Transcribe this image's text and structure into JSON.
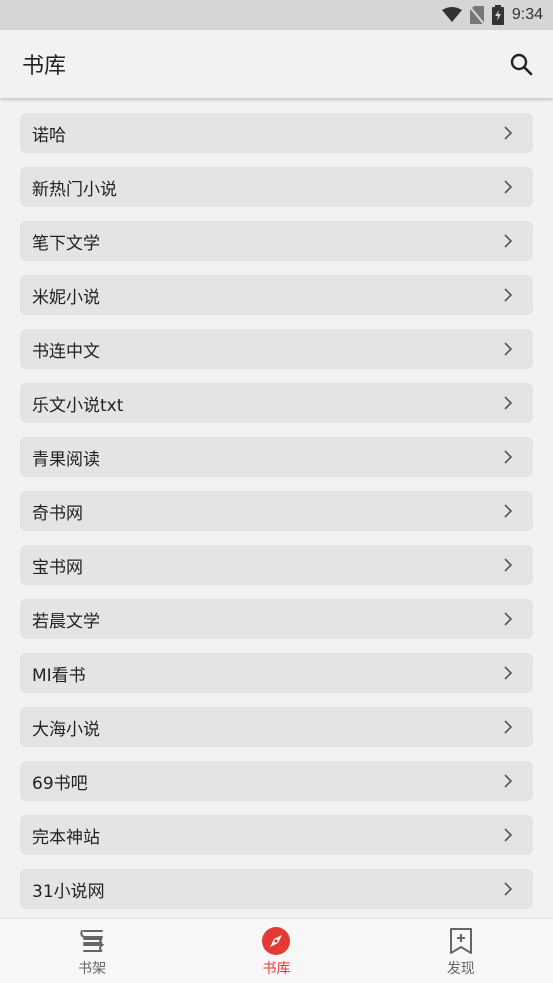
{
  "status_bar": {
    "time": "9:34",
    "icons": [
      "wifi-icon",
      "no-sim-icon",
      "battery-charging-icon"
    ]
  },
  "app_bar": {
    "title": "书库",
    "search_icon": "search-icon"
  },
  "sources": [
    "诺哈",
    "新热门小说",
    "笔下文学",
    "米妮小说",
    "书连中文",
    "乐文小说txt",
    "青果阅读",
    "奇书网",
    "宝书网",
    "若晨文学",
    "MI看书",
    "大海小说",
    "69书吧",
    "完本神站",
    "31小说网"
  ],
  "bottom_nav": {
    "tabs": [
      {
        "label": "书架",
        "icon": "bookshelf-icon",
        "active": false
      },
      {
        "label": "书库",
        "icon": "compass-icon",
        "active": true
      },
      {
        "label": "发现",
        "icon": "bookmark-add-icon",
        "active": false
      }
    ]
  },
  "colors": {
    "accent": "#e53935",
    "background": "#f2f2f2",
    "item_bg": "#e4e4e4"
  }
}
